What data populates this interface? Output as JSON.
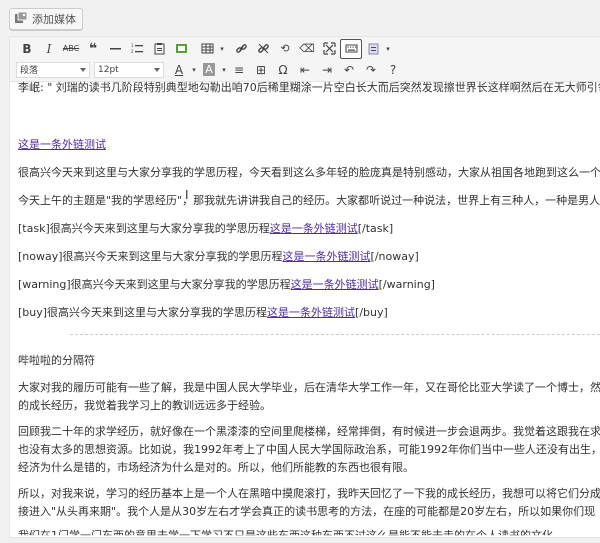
{
  "media": {
    "add_media_label": "添加媒体"
  },
  "toolbar": {
    "row1_icons": [
      "bold-icon",
      "italic-icon",
      "strikethrough-icon",
      "horizontal-rule-icon",
      "blockquote-icon",
      "numbered-list-icon",
      "paste-icon",
      "insert-image-icon",
      "table-icon",
      "link-icon",
      "unlink-icon",
      "fullscreen-icon",
      "clear-format-icon",
      "expand-icon",
      "keyboard-icon",
      "text-color-icon"
    ],
    "format_select": "段落",
    "font_size_select": "12pt"
  },
  "content": {
    "first_line": "李岷: \" 刘瑞的读书几阶段特别典型地勾勒出咱70后稀里糊涂一片空白长大而后突然发现擦世界长这样啊然后在无大师引领",
    "link_only": "这是一条外链测试",
    "para1": "很高兴今天来到这里与大家分享我的学思历程，今天看到这么多年轻的脸庞真是特别感动，大家从祖国各地跑到这么一个",
    "para2": "今天上午的主题是\"我的学思经历\"，那我就先讲讲我自己的经历。大家都听说过一种说法，世界上有三种人，一种是男人",
    "task_open": "[task]",
    "task_text": "很高兴今天来到这里与大家分享我的学思历程",
    "task_close": "[/task]",
    "noway_open": "[noway]",
    "noway_text": "很高兴今天来到这里与大家分享我的学思历程",
    "noway_close": "[/noway]",
    "warning_open": "[warning]",
    "warning_text": "很高兴今天来到这里与大家分享我的学思历程",
    "warning_close": "[/warning]",
    "buy_open": "[buy]",
    "buy_text": "很高兴今天来到这里与大家分享我的学思历程",
    "buy_close": "[/buy]",
    "section_heading": "哔啦啦的分隔符",
    "p3_line1": "大家对我的履历可能有一些了解，我是中国人民大学毕业，后在清华大学工作一年，又在哥伦比亚大学读了一个博士，然",
    "p3_line2": "的成长经历，我觉着我学习上的教训远远多于经验。",
    "p4_line1": "回顾我二十年的求学经历，就好像在一个黑漆漆的空间里爬楼梯，经常摔倒，有时候进一步会退两步。我觉着这跟我在求",
    "p4_line2": "也没有太多的思想资源。比如说，我1992年考上了中国人民大学国际政治系，可能1992年你们当中一些人还没有出生，我",
    "p4_line3": "经济为什么是错的，市场经济为什么是对的。所以，他们所能教的东西也很有限。",
    "p5_line1": "所以，对我来说，学习的经历基本上是一个人在黑暗中摸爬滚打，我昨天回忆了一下我的成长经历，我想可以将它们分成",
    "p5_line2": "接进入\"从头再来期\"。我个人是从30岁左右才学会真正的读书思考的方法，在座的可能都是20岁左右，所以如果你们现",
    "p6_partial": "我们在1门学一门东西的意思去学一下学习不只是这些东西这种东西不过这么是能不能去走的在个人读书的文化"
  },
  "colors": {
    "link": "#4f2d9a",
    "text": "#333333",
    "toolbar_bg": "#f5f5f5"
  }
}
